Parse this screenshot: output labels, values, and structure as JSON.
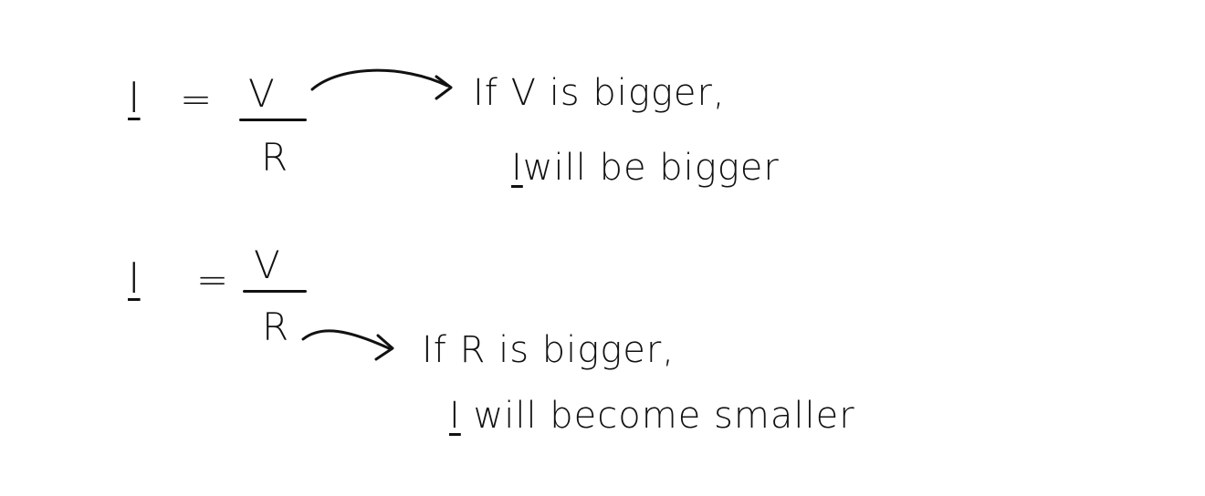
{
  "equation1": {
    "lhs": "I",
    "equals": "=",
    "numerator": "V",
    "denominator": "R"
  },
  "note1": {
    "prefix": "If",
    "line1_rest": "V is bigger,",
    "line2_subject": "I",
    "line2_rest": "will be bigger"
  },
  "equation2": {
    "lhs": "I",
    "equals": "=",
    "numerator": "V",
    "denominator": "R"
  },
  "note2": {
    "prefix": "If",
    "line1_rest": "R is bigger,",
    "line2_subject": "I",
    "line2_rest": "will become smaller"
  },
  "colors": {
    "ink": "#111111",
    "paper": "#ffffff"
  }
}
